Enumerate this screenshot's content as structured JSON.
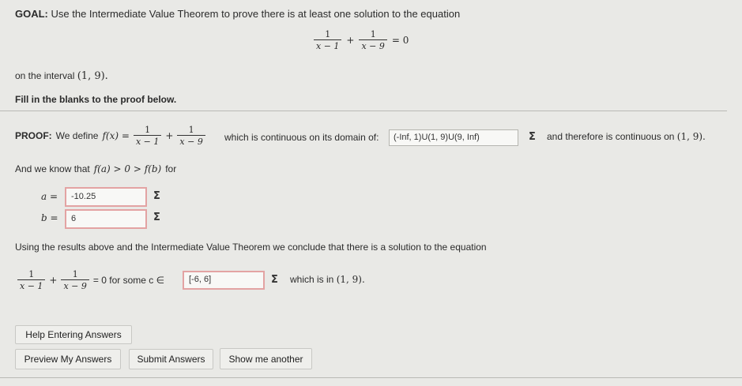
{
  "goal": {
    "label": "GOAL:",
    "text": "Use the Intermediate Value Theorem to prove there is at least one solution to the equation"
  },
  "equation": {
    "num1": "1",
    "den1": "x − 1",
    "plus": "+",
    "num2": "1",
    "den2": "x − 9",
    "eq": "= 0"
  },
  "interval_text": "on the interval",
  "interval_math": "(1, 9).",
  "fill_blanks": "Fill in the blanks to the proof below.",
  "proof": {
    "label": "PROOF:",
    "define": "We define",
    "fx": "f(x) =",
    "continuous_text": "which is continuous on its domain of:",
    "domain_value": "(-Inf, 1)U(1, 9)U(9, Inf)",
    "therefore_text": "and therefore is continuous on",
    "therefore_math": "(1, 9).",
    "know_text": "And we know that",
    "know_math": "f(a) > 0 > f(b)",
    "for_text": "for"
  },
  "inputs": {
    "a_label": "a =",
    "a_value": "-10.25",
    "b_label": "b =",
    "b_value": "6"
  },
  "conclusion": {
    "text": "Using the results above and the Intermediate Value Theorem we conclude that there is a solution to the equation",
    "for_some": "= 0 for some c ∈",
    "c_value": "[-6, 6]",
    "which_in": "which is in",
    "which_math": "(1, 9)."
  },
  "sigma_symbol": "Σ",
  "buttons": {
    "help": "Help Entering Answers",
    "preview": "Preview My Answers",
    "submit": "Submit Answers",
    "show_another": "Show me another"
  }
}
